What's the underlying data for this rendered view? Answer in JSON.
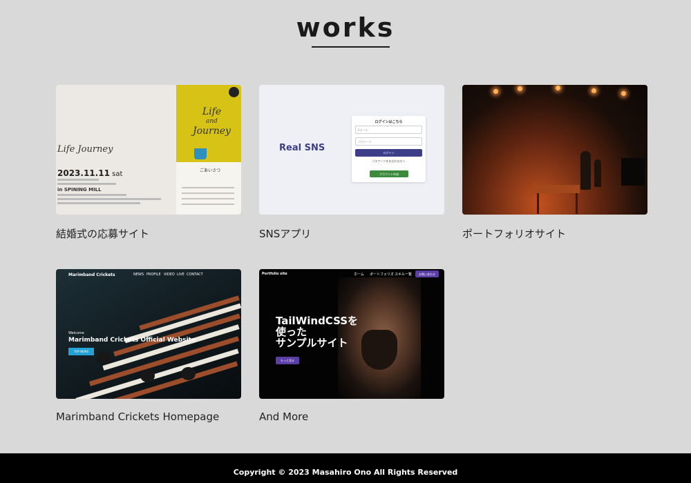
{
  "page": {
    "title": "works",
    "background": "#d9d9d9"
  },
  "works": [
    {
      "label": "結婚式の応募サイト",
      "thumbnail": {
        "logo": "Life Journey",
        "date_main": "2023.11.11",
        "date_day": "sat",
        "location": "in SPINING MILL",
        "cover_title_1": "Life",
        "cover_title_2": "and",
        "cover_title_3": "Journey",
        "greeting": "ごあいさつ"
      }
    },
    {
      "label": "SNSアプリ",
      "thumbnail": {
        "logo": "Real SNS",
        "panel_title": "ログインはこちら",
        "email_placeholder": "Eメール",
        "password_placeholder": "パスワード",
        "login_button": "ログイン",
        "forgot_link": "パスワードをお忘れの方へ",
        "create_button": "アカウント作成"
      }
    },
    {
      "label": "ポートフォリオサイト"
    },
    {
      "label": "Marimband Crickets Homepage",
      "thumbnail": {
        "brand": "Marimband Crickets",
        "nav": [
          "NEWS",
          "PROFILE",
          "VIDEO",
          "LIVE",
          "CONTACT"
        ],
        "welcome": "Welcome",
        "heading": "Marimband Crickets Official Website",
        "button": "TOP NEWS"
      }
    },
    {
      "label": "And More",
      "thumbnail": {
        "brand": "Portfolio site",
        "nav": [
          "ホーム",
          "ポートフォリオ",
          "スキル一覧"
        ],
        "contact": "お問い合わせ",
        "heading_1": "TailWindCSSを",
        "heading_2": "使った",
        "heading_3": "サンプルサイト",
        "button": "もっと見る"
      }
    }
  ],
  "footer": {
    "copyright": "Copyright © 2023 Masahiro Ono All Rights Reserved"
  }
}
